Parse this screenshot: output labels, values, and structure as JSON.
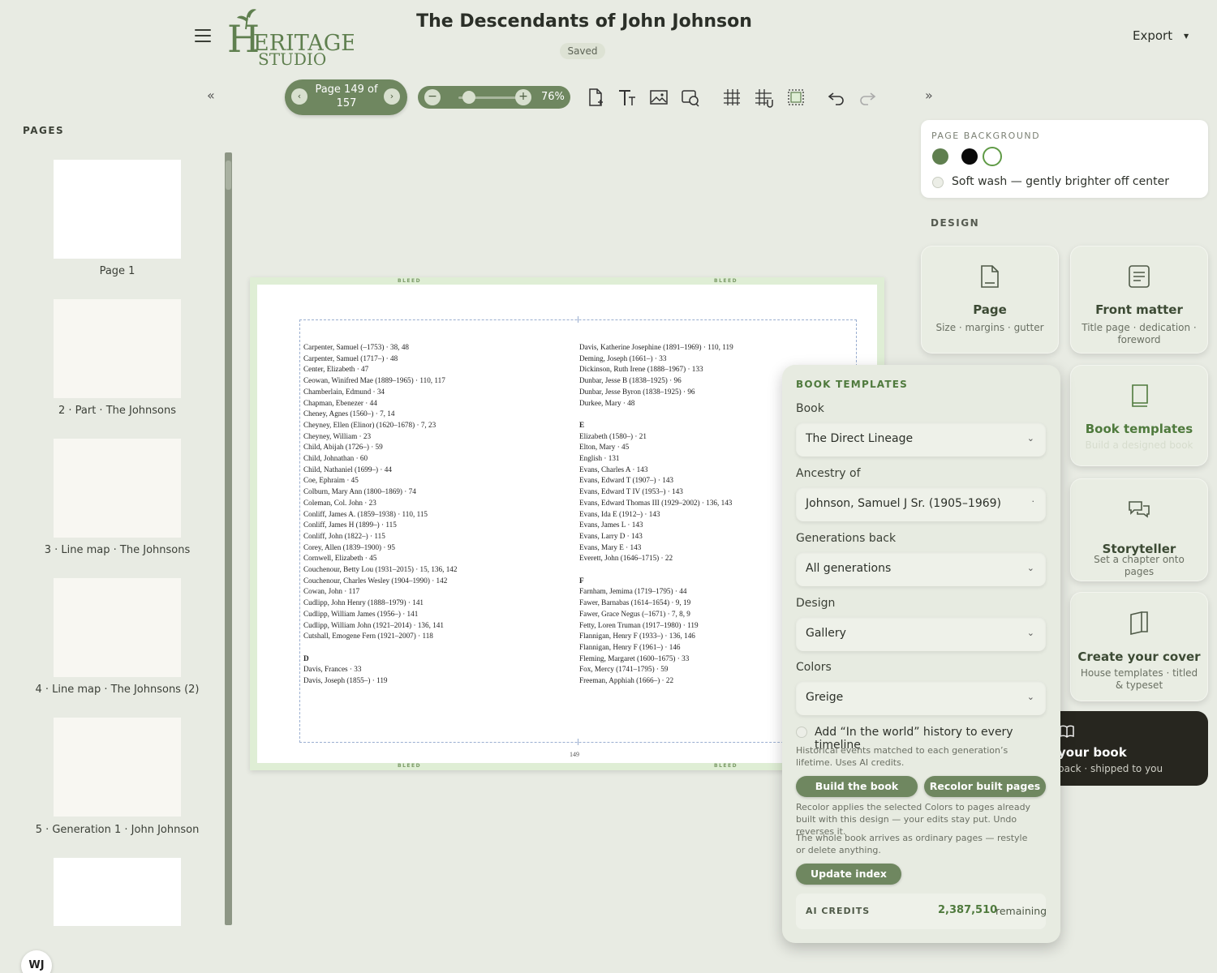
{
  "header": {
    "logo_text": "HERITAGE STUDIO",
    "doc_title": "The Descendants of John Johnson",
    "saved_label": "Saved",
    "export_label": "Export"
  },
  "toolbar": {
    "pager_text": "Page 149 of 157",
    "zoom_value": "76%",
    "zoom_level": 0.76,
    "tools": [
      "add-page-icon",
      "add-text-icon",
      "add-image-icon",
      "add-shape-icon",
      "grid-icon",
      "snap-grid-icon",
      "bleed-frame-icon",
      "undo-icon",
      "redo-icon"
    ]
  },
  "pages_panel": {
    "label": "PAGES",
    "items": [
      {
        "label": "Page 1"
      },
      {
        "label": "2 · Part · The Johnsons"
      },
      {
        "label": "3 · Line map · The Johnsons"
      },
      {
        "label": "4 · Line map · The Johnsons (2)"
      },
      {
        "label": "5 · Generation 1 · John Johnson"
      },
      {
        "label": ""
      }
    ],
    "avatar": "WJ"
  },
  "spread": {
    "bleed_label": "BLEED",
    "folio": "149",
    "left_column": [
      "Carpenter, Samuel (–1753)  ·  38, 48",
      "Carpenter, Samuel (1717–)  ·  48",
      "Center, Elizabeth  ·  47",
      "Ceowan, Winifred Mae (1889–1965)  ·  110, 117",
      "Chamberlain, Edmund  ·  34",
      "Chapman, Ebenezer  ·  44",
      "Cheney, Agnes (1560–)  ·  7, 14",
      "Cheyney, Ellen (Elinor) (1620–1678)  ·  7, 23",
      "Cheyney, William  ·  23",
      "Child, Abijah (1726–)  ·  59",
      "Child, Johnathan  ·  60",
      "Child, Nathaniel (1699–)  ·  44",
      "Coe, Ephraim  ·  45",
      "Colburn, Mary Ann (1800–1869)  ·  74",
      "Coleman, Col. John  ·  23",
      "Conliff, James A. (1859–1938)  ·  110, 115",
      "Conliff, James H (1899–)  ·  115",
      "Conliff, John (1822–)  ·  115",
      "Corey, Allen (1839–1900)  ·  95",
      "Cornwell, Elizabeth  ·  45",
      "Couchenour, Betty Lou (1931–2015)  ·  15, 136, 142",
      "Couchenour, Charles Wesley (1904–1990)  ·  142",
      "Cowan, John  ·  117",
      "Cudlipp, John Henry (1888–1979)  ·  141",
      "Cudlipp, William James (1956–)  ·  141",
      "Cudlipp, William John (1921–2014)  ·  136, 141",
      "Cutshall, Emogene Fern (1921–2007)  ·  118",
      "",
      "D",
      "Davis, Frances  ·  33",
      "Davis, Joseph (1855–)  ·  119"
    ],
    "right_column": [
      "Davis, Katherine Josephine (1891–1969)  ·  110, 119",
      "Deming, Joseph (1661–)  ·  33",
      "Dickinson, Ruth Irene (1888–1967)  ·  133",
      "Dunbar, Jesse B (1838–1925)  ·  96",
      "Dunbar, Jesse Byron (1838–1925)  ·  96",
      "Durkee, Mary  ·  48",
      "",
      "E",
      "Elizabeth (1580–)  ·  21",
      "Elton, Mary  ·  45",
      "English  ·  131",
      "Evans, Charles A  ·  143",
      "Evans, Edward T (1907–)  ·  143",
      "Evans, Edward T IV (1953–)  ·  143",
      "Evans, Edward Thomas III (1929–2002)  ·  136, 143",
      "Evans, Ida E (1912–)  ·  143",
      "Evans, James L  ·  143",
      "Evans, Larry D  ·  143",
      "Evans, Mary E  ·  143",
      "Everett, John (1646–1715)  ·  22",
      "",
      "F",
      "Farnham, Jemima (1719–1795)  ·  44",
      "Fawer, Barnabas (1614–1654)  ·  9, 19",
      "Fawer, Grace Negus (–1671)  ·  7, 8, 9",
      "Fetty, Loren Truman (1917–1980)  ·  119",
      "Flannigan, Henry F (1933–)  ·  136, 146",
      "Flannigan, Henry F (1961–)  ·  146",
      "Fleming, Margaret (1600–1675)  ·  33",
      "Fox, Mercy (1741–1795)  ·  59",
      "Freeman, Apphiah (1666–)  ·  22"
    ]
  },
  "page_background": {
    "label": "PAGE BACKGROUND",
    "swatches": [
      "#5f7f4f",
      "#0a0a0a",
      "#ffffff"
    ],
    "option_label": "Soft wash — gently brighter off center"
  },
  "design": {
    "label": "DESIGN",
    "cards": [
      {
        "title": "Page",
        "subtitle": "Size · margins · gutter"
      },
      {
        "title": "Front matter",
        "subtitle": "Title page · dedication · foreword"
      },
      {
        "title": "Book templates",
        "subtitle": "Build a designed book"
      },
      {
        "title": "Storyteller",
        "subtitle": "Set a chapter onto pages"
      },
      {
        "title": "Create your cover",
        "subtitle": "House templates · titled & typeset"
      },
      {
        "title": "your book",
        "subtitle": "back · shipped to you"
      }
    ]
  },
  "book_templates": {
    "title": "BOOK TEMPLATES",
    "book_label": "Book",
    "book_value": "The Direct Lineage",
    "ancestry_label": "Ancestry of",
    "ancestry_value": "Johnson, Samuel J Sr. (1905–1969)",
    "generations_label": "Generations back",
    "generations_value": "All generations",
    "design_label": "Design",
    "design_value": "Gallery",
    "colors_label": "Colors",
    "colors_value": "Greige",
    "history_label": "Add “In the world” history to every timeline",
    "history_note": "Historical events matched to each generation’s lifetime. Uses AI credits.",
    "build_label": "Build the book",
    "recolor_label": "Recolor built pages",
    "recolor_note": "Recolor applies the selected Colors to pages already built with this design — your edits stay put. Undo reverses it.",
    "whole_note": "The whole book arrives as ordinary pages — restyle or delete anything.",
    "update_label": "Update index",
    "credits_label": "AI CREDITS",
    "credits_value": "2,387,510",
    "credits_suffix": "remaining"
  },
  "colors": {
    "accent": "#6f8760",
    "accent_text": "#4f7a3d",
    "background": "#e8ebe3"
  }
}
